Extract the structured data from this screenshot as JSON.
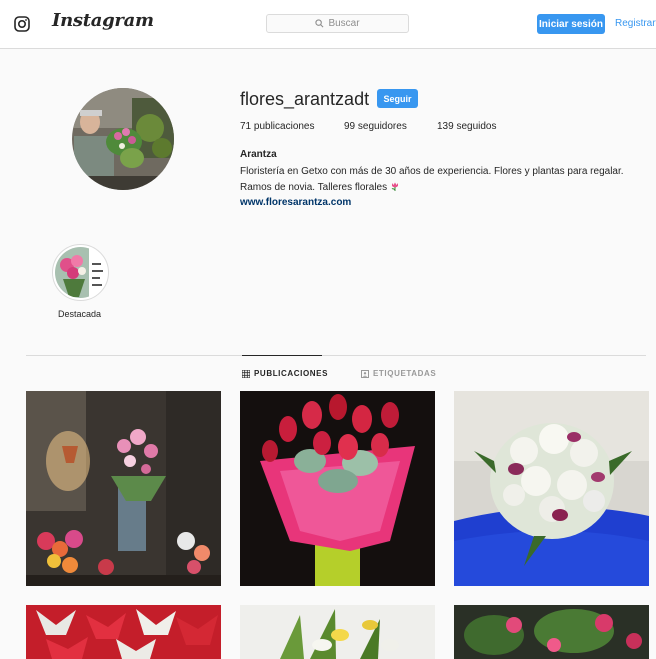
{
  "header": {
    "logo_text": "Instagram",
    "search_placeholder": "Buscar",
    "login_label": "Iniciar sesión",
    "register_label": "Registrarte"
  },
  "profile": {
    "username": "flores_arantzadt",
    "follow_label": "Seguir",
    "posts": "71 publicaciones",
    "followers": "99 seguidores",
    "following": "139 seguidos",
    "name": "Arantza",
    "bio_line1": "Floristería en Getxo con más de 30 años de experiencia. Flores y plantas para regalar.",
    "bio_line2": "Ramos de novia. Talleres florales",
    "website": "www.floresarantza.com"
  },
  "highlights": [
    {
      "label": "Destacada"
    }
  ],
  "tabs": [
    {
      "label": "PUBLICACIONES",
      "active": true
    },
    {
      "label": "ETIQUETADAS",
      "active": false
    }
  ],
  "colors": {
    "accent": "#3897f0",
    "link": "#003569",
    "border": "#dbdbdb"
  }
}
